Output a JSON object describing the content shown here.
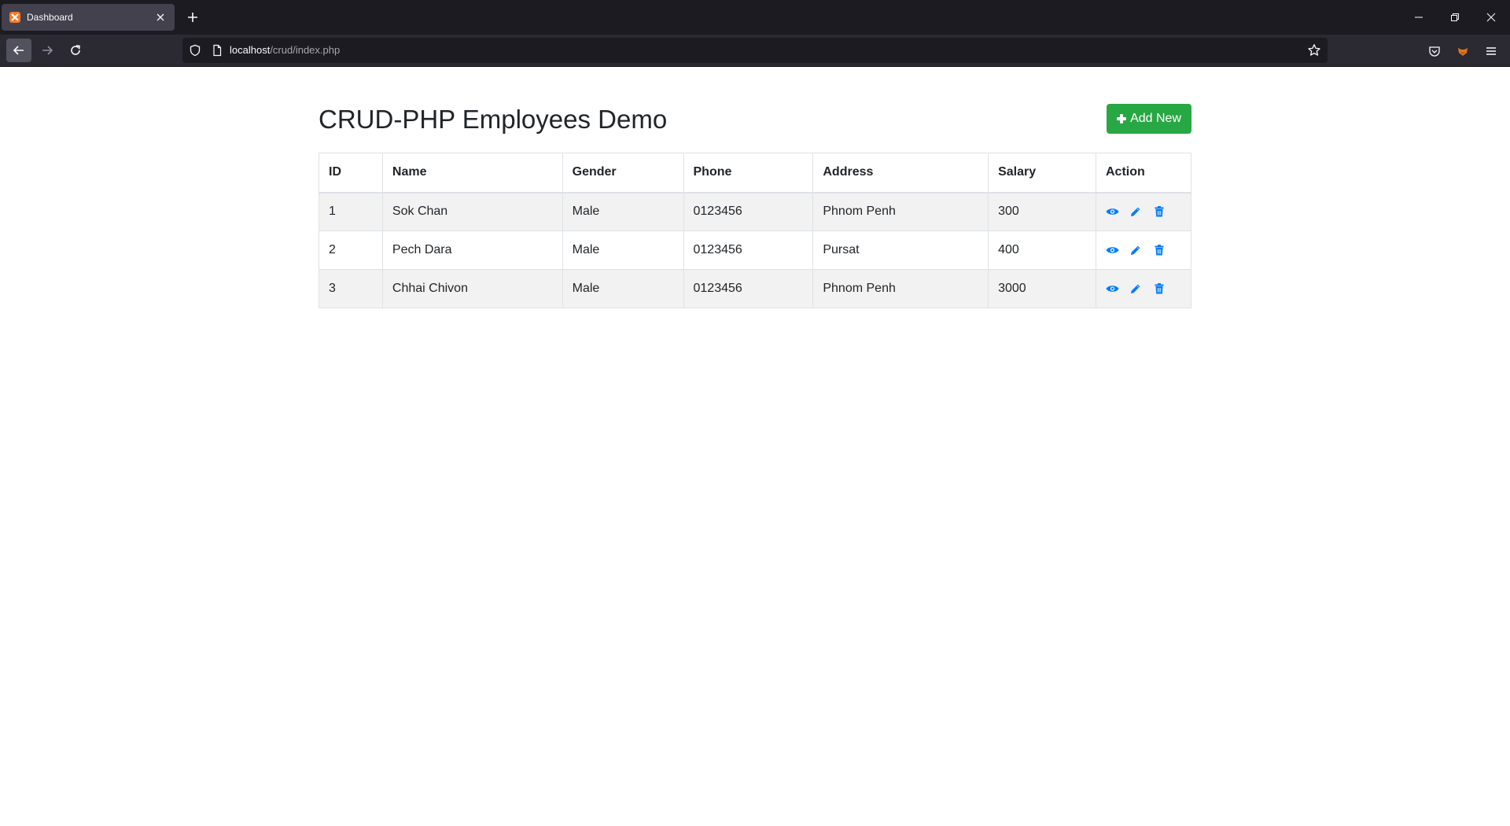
{
  "browser": {
    "tab_title": "Dashboard",
    "url_host": "localhost",
    "url_path": "/crud/index.php"
  },
  "page": {
    "title": "CRUD-PHP Employees Demo",
    "add_button_label": "Add New"
  },
  "table": {
    "headers": {
      "id": "ID",
      "name": "Name",
      "gender": "Gender",
      "phone": "Phone",
      "address": "Address",
      "salary": "Salary",
      "action": "Action"
    },
    "rows": [
      {
        "id": "1",
        "name": "Sok Chan",
        "gender": "Male",
        "phone": "0123456",
        "address": "Phnom Penh",
        "salary": "300"
      },
      {
        "id": "2",
        "name": "Pech Dara",
        "gender": "Male",
        "phone": "0123456",
        "address": "Pursat",
        "salary": "400"
      },
      {
        "id": "3",
        "name": "Chhai Chivon",
        "gender": "Male",
        "phone": "0123456",
        "address": "Phnom Penh",
        "salary": "3000"
      }
    ]
  },
  "colors": {
    "add_button": "#28a745",
    "action_icon": "#007bff",
    "row_stripe": "#f2f2f2",
    "chrome_dark": "#1c1b22"
  },
  "icons": [
    "xampp-favicon",
    "close-icon",
    "plus-icon",
    "minimize-icon",
    "restore-icon",
    "window-close-icon",
    "back-icon",
    "forward-icon",
    "reload-icon",
    "shield-icon",
    "page-icon",
    "star-icon",
    "pocket-icon",
    "extension-fox-icon",
    "menu-icon",
    "eye-icon",
    "pencil-icon",
    "trash-icon"
  ]
}
